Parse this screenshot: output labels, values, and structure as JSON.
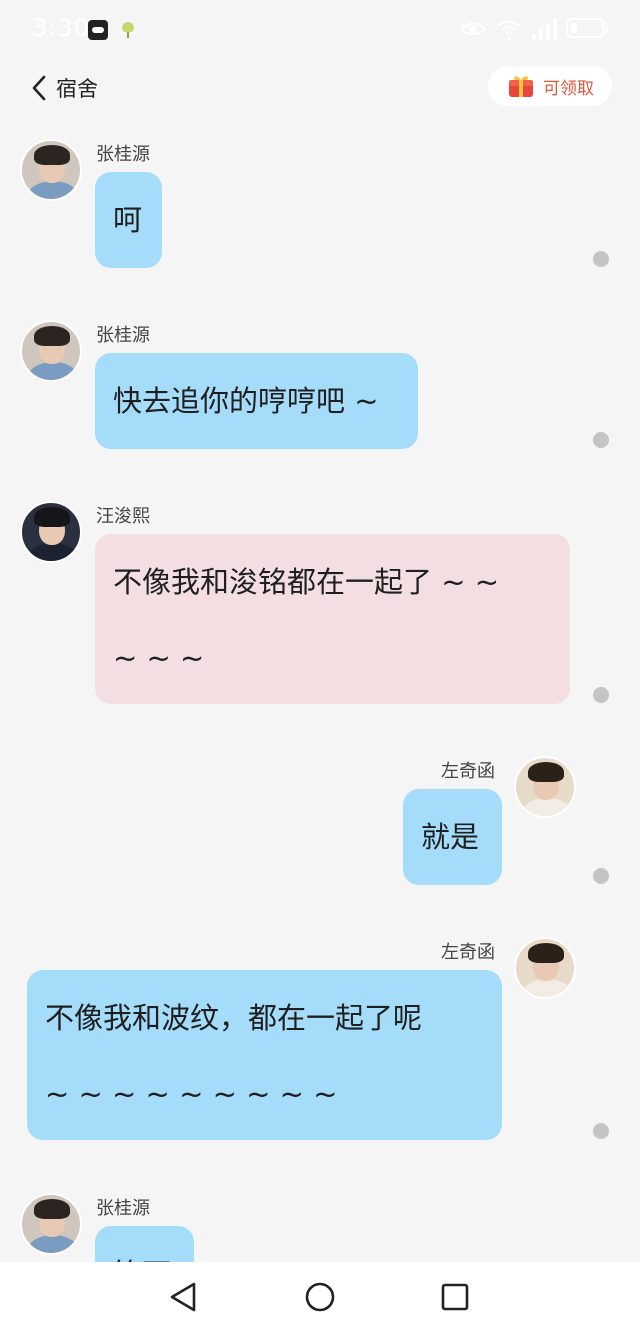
{
  "status_bar": {
    "time": "3:30",
    "icons": [
      "notification-app-icon",
      "notification-app-icon-2",
      "eye-icon",
      "wifi-icon",
      "signal-icon",
      "battery-icon"
    ]
  },
  "header": {
    "title": "宿舍",
    "back_icon": "chevron-left-icon",
    "reward_label": "可领取",
    "reward_icon": "gift-box-icon",
    "reward_color": "#e05a3c"
  },
  "messages": [
    {
      "sender": "张桂源",
      "side": "left",
      "lines": [
        "呵"
      ],
      "color": "#a5dcfa"
    },
    {
      "sender": "张桂源",
      "side": "left",
      "lines": [
        "快去追你的哼哼吧 ~"
      ],
      "color": "#a5dcfa"
    },
    {
      "sender": "汪浚熙",
      "side": "left",
      "lines": [
        "不像我和浚铭都在一起了 ~ ~",
        "~ ~ ~"
      ],
      "color": "#f3dfe1"
    },
    {
      "sender": "左奇函",
      "side": "right",
      "lines": [
        "就是"
      ],
      "color": "#a5dcfa"
    },
    {
      "sender": "左奇函",
      "side": "right",
      "lines": [
        "不像我和波纹，都在一起了呢",
        "~ ~ ~ ~ ~ ~ ~ ~ ~"
      ],
      "color": "#a5dcfa"
    },
    {
      "sender": "张桂源",
      "side": "left",
      "lines": [
        "等下"
      ],
      "color": "#a5dcfa"
    }
  ],
  "nav_bar": {
    "icons": [
      "triangle-back-icon",
      "circle-home-icon",
      "square-recents-icon"
    ]
  }
}
